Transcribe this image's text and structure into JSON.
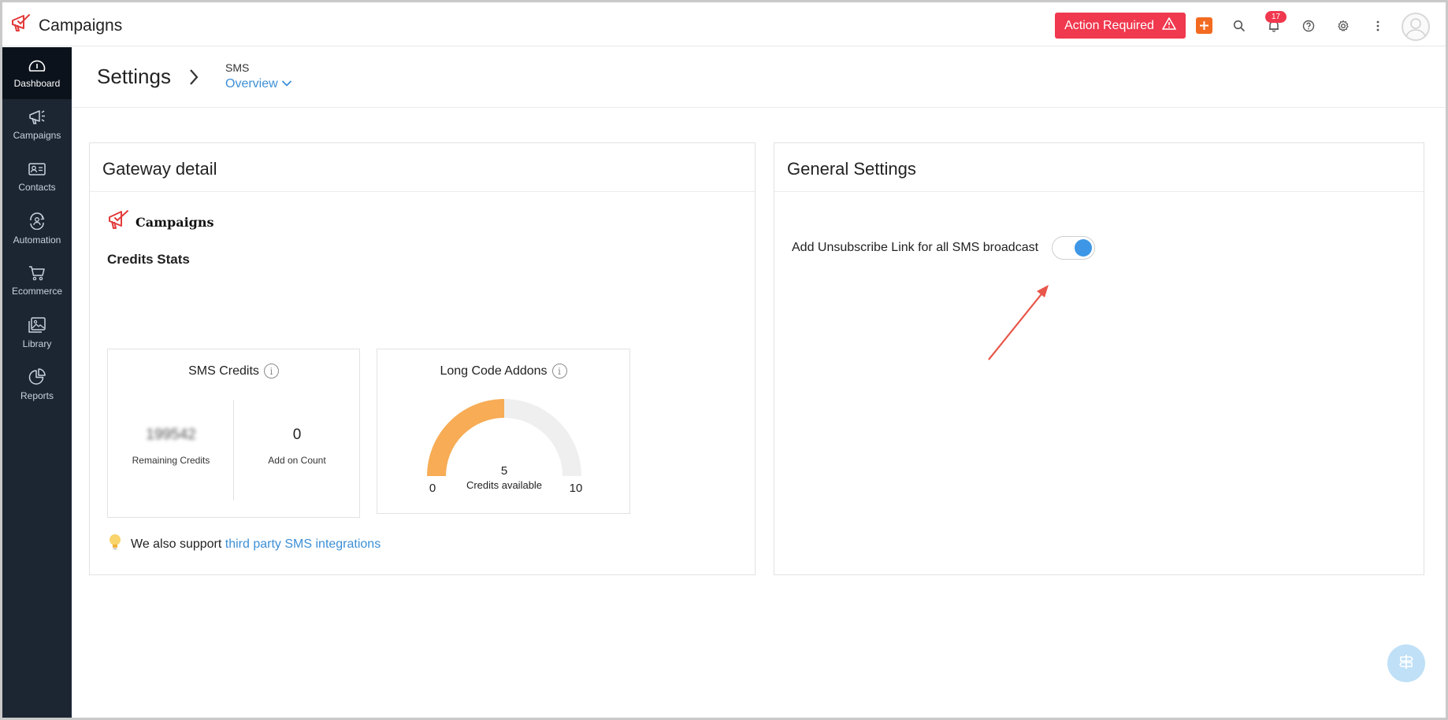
{
  "app": {
    "title": "Campaigns"
  },
  "topbar": {
    "action_required_label": "Action Required",
    "notification_count": "17",
    "icons": [
      "add-icon",
      "search-icon",
      "bell-icon",
      "help-icon",
      "gear-icon",
      "more-vertical-icon",
      "user-avatar"
    ]
  },
  "sidebar": {
    "items": [
      {
        "label": "Dashboard",
        "icon": "dashboard-icon",
        "active": true
      },
      {
        "label": "Campaigns",
        "icon": "megaphone-icon"
      },
      {
        "label": "Contacts",
        "icon": "contact-card-icon"
      },
      {
        "label": "Automation",
        "icon": "automation-icon"
      },
      {
        "label": "Ecommerce",
        "icon": "cart-icon"
      },
      {
        "label": "Library",
        "icon": "image-library-icon"
      },
      {
        "label": "Reports",
        "icon": "pie-chart-icon"
      }
    ]
  },
  "header": {
    "title": "Settings",
    "breadcrumb_section": "SMS",
    "breadcrumb_view": "Overview"
  },
  "gateway": {
    "title": "Gateway detail",
    "brand_name": "Campaigns",
    "credits_stats_label": "Credits Stats",
    "sms_credits": {
      "title": "SMS Credits",
      "remaining_value": "199542",
      "remaining_label": "Remaining Credits",
      "addon_value": "0",
      "addon_label": "Add on Count"
    },
    "long_code": {
      "title": "Long Code Addons",
      "value": "5",
      "value_label": "Credits available",
      "min": "0",
      "max": "10",
      "fraction": 0.5
    },
    "tip_prefix": "We also support",
    "tip_link": "third party SMS integrations"
  },
  "general": {
    "title": "General Settings",
    "unsubscribe_label": "Add Unsubscribe Link for all SMS broadcast",
    "unsubscribe_enabled": true
  },
  "colors": {
    "sidebar_bg": "#1c2633",
    "action_red": "#f0384e",
    "plus_orange": "#f26b21",
    "link_blue": "#3c8fd6",
    "gauge_fill": "#f7ac55",
    "gauge_track": "#efefef",
    "toggle_on": "#3d97e6",
    "annotation_arrow": "#e8574a"
  }
}
